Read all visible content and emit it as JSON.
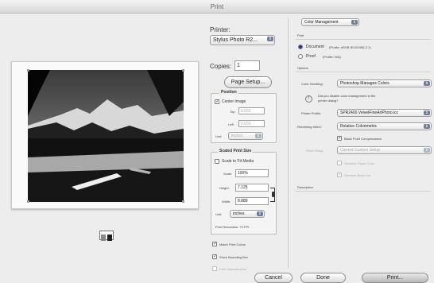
{
  "window": {
    "title": "Print"
  },
  "printer": {
    "label": "Printer:",
    "value": "Stylus Photo R2..."
  },
  "copies": {
    "label": "Copies:",
    "value": "1"
  },
  "buttons": {
    "page_setup": "Page Setup...",
    "cancel": "Cancel",
    "done": "Done",
    "print": "Print..."
  },
  "position": {
    "title": "Position",
    "center_image": "Center Image",
    "top_label": "Top:",
    "top_value": "0.033",
    "left_label": "Left:",
    "left_value": "0.033",
    "unit_label": "Unit:",
    "unit_value": "inches"
  },
  "scaled": {
    "title": "Scaled Print Size",
    "scale_to_fit": "Scale to Fit Media",
    "scale_label": "Scale:",
    "scale_value": "100%",
    "height_label": "Height:",
    "height_value": "7.125",
    "width_label": "Width:",
    "width_value": "8.889",
    "unit_label": "Unit:",
    "unit_value": "inches",
    "resolution": "Print Resolution: 72 PPI"
  },
  "options_left": {
    "match_print_colors": "Match Print Colors",
    "show_bounding_box": "Show Bounding Box",
    "print_selected_area": "Print Selected Area"
  },
  "right": {
    "mode": "Color Management",
    "print_heading": "Print",
    "document_label": "Document",
    "document_profile": "(Profile: sRGB IEC61966-2.1)",
    "proof_label": "Proof",
    "proof_profile": "(Profile: N/A)",
    "options_heading": "Options",
    "color_handling_label": "Color Handling:",
    "color_handling_value": "Photoshop Manages Colors",
    "note": "Did you disable color management in the printer dialog?",
    "printer_profile_label": "Printer Profile:",
    "printer_profile_value": "SPR2400 VelvetFineArtPhoto.icc",
    "rendering_intent_label": "Rendering Intent:",
    "rendering_intent_value": "Relative Colorimetric",
    "black_point": "Black Point Compensation",
    "proof_setup_label": "Proof Setup:",
    "proof_setup_value": "Current Custom Setup",
    "simulate_paper": "Simulate Paper Color",
    "simulate_black": "Simulate Black Ink",
    "description_heading": "Description"
  }
}
